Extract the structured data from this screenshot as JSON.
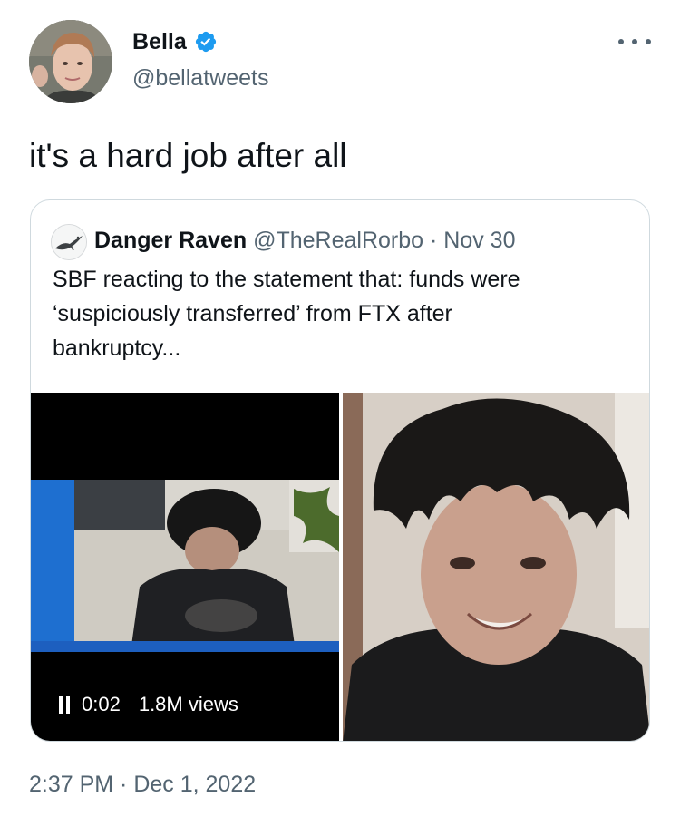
{
  "tweet": {
    "author": {
      "name": "Bella",
      "handle": "@bellatweets",
      "verified": true,
      "avatar_icon": "profile-photo"
    },
    "text": "it's a hard job after all",
    "more_icon": "ellipsis-icon",
    "timestamp": "2:37 PM · Dec 1, 2022"
  },
  "quoted_tweet": {
    "author": {
      "name": "Danger Raven",
      "handle": "@TheRealRorbo",
      "avatar_icon": "bird-sketch-avatar"
    },
    "separator": "·",
    "date": "Nov 30",
    "text_lines": [
      "SBF reacting to the statement that: funds were",
      "‘suspiciously transferred’ from FTX after",
      "bankruptcy..."
    ],
    "media": {
      "video": {
        "time": "0:02",
        "views": "1.8M views",
        "control_icon": "pause-icon"
      },
      "photo_icon": "photo"
    }
  },
  "colors": {
    "text_primary": "#0f1419",
    "text_secondary": "#536471",
    "verified_blue": "#1d9bf0",
    "border": "#cfd9de"
  }
}
